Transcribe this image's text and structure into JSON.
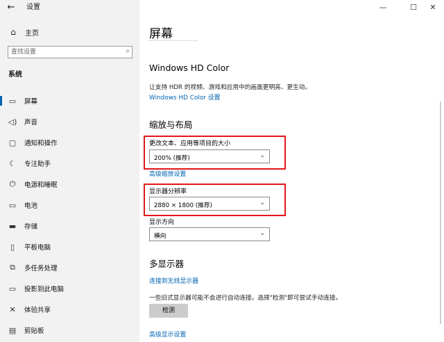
{
  "window": {
    "back_icon": "back-arrow-icon",
    "title": "设置",
    "controls": [
      "minimize-icon",
      "maximize-icon",
      "close-icon"
    ]
  },
  "sidebar": {
    "home_label": "主页",
    "home_icon": "home-icon",
    "search_placeholder": "查找设置",
    "search_icon": "search-icon",
    "section_label": "系统",
    "items": [
      {
        "label": "屏幕",
        "icon": "display-icon",
        "active": true
      },
      {
        "label": "声音",
        "icon": "speaker-icon",
        "active": false
      },
      {
        "label": "通知和操作",
        "icon": "notification-icon",
        "active": false
      },
      {
        "label": "专注助手",
        "icon": "moon-icon",
        "active": false
      },
      {
        "label": "电源和睡眠",
        "icon": "power-icon",
        "active": false
      },
      {
        "label": "电池",
        "icon": "battery-icon",
        "active": false
      },
      {
        "label": "存储",
        "icon": "storage-icon",
        "active": false
      },
      {
        "label": "平板电脑",
        "icon": "tablet-icon",
        "active": false
      },
      {
        "label": "多任务处理",
        "icon": "multitask-icon",
        "active": false
      },
      {
        "label": "投影到此电脑",
        "icon": "projector-icon",
        "active": false
      },
      {
        "label": "体验共享",
        "icon": "share-icon",
        "active": false
      },
      {
        "label": "剪贴板",
        "icon": "clipboard-icon",
        "active": false
      }
    ]
  },
  "main": {
    "title": "屏幕",
    "hdr": {
      "heading": "Windows HD Color",
      "description": "让支持 HDR 的视频、游戏和应用中的画面更明亮、更生动。",
      "link": "Windows HD Color 设置"
    },
    "scale": {
      "heading": "缩放与布局",
      "size_label": "更改文本、应用等项目的大小",
      "size_value": "200% (推荐)",
      "advanced_link": "高级缩放设置",
      "resolution_label": "显示器分辨率",
      "resolution_value": "2880 × 1800 (推荐)",
      "orientation_label": "显示方向",
      "orientation_value": "横向"
    },
    "multi": {
      "heading": "多显示器",
      "wireless_link": "连接到无线显示器",
      "description": "一些旧式显示器可能不会进行自动连接。选择\"检测\"即可尝试手动连接。",
      "detect_button": "检测",
      "advanced_link": "高级显示设置"
    }
  },
  "colors": {
    "accent": "#0063b1",
    "highlight_box": "#e2161a",
    "sidebar_bg": "#f2f2f2"
  }
}
